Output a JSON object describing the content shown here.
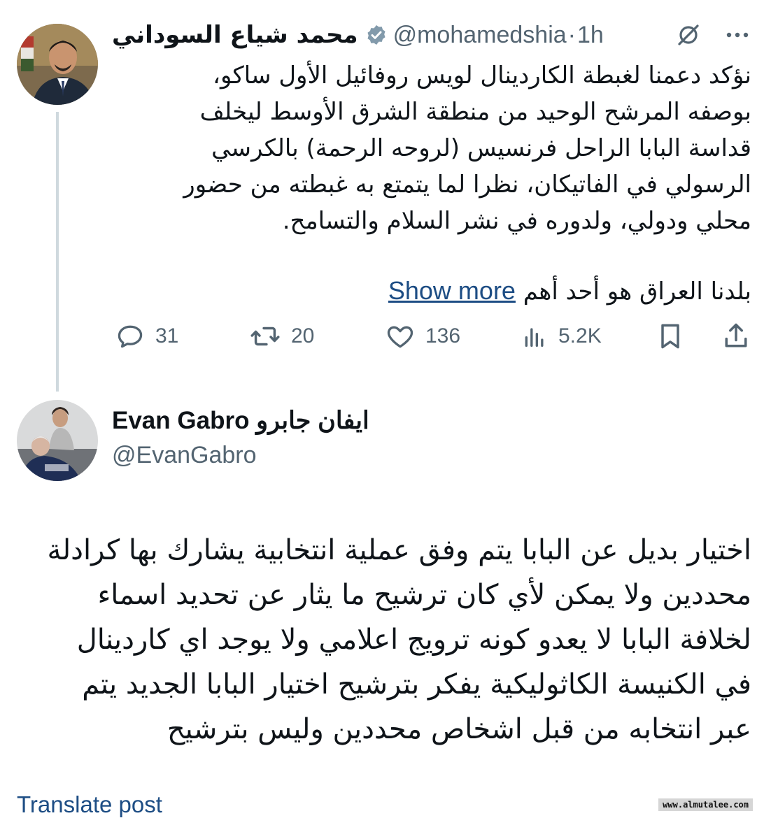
{
  "tweet": {
    "author_name": "محمد شياع السوداني",
    "handle": "@mohamedshia",
    "separator": "·",
    "time": "1h",
    "body_lines": [
      "نؤكد دعمنا لغبطة الكاردينال لويس روفائيل الأول ساكو،",
      "بوصفه المرشح الوحيد من منطقة الشرق الأوسط ليخلف",
      "قداسة البابا الراحل فرنسيس (لروحه الرحمة) بالكرسي",
      "الرسولي في الفاتيكان، نظرا لما يتمتع به غبطته من حضور",
      "محلي ودولي، ولدوره في نشر السلام والتسامح."
    ],
    "body_second_paragraph": "بلدنا العراق هو أحد أهم",
    "show_more_label": "Show more",
    "stats": {
      "replies": "31",
      "reposts": "20",
      "likes": "136",
      "views": "5.2K"
    }
  },
  "reply": {
    "author_name": "Evan Gabro ايفان جابرو",
    "handle": "@EvanGabro",
    "body_lines": [
      "اختيار بديل عن البابا يتم وفق عملية انتخابية يشارك بها كرادلة",
      "محددين ولا يمكن لأي كان ترشيح ما يثار عن تحديد اسماء",
      "لخلافة البابا لا يعدو كونه ترويج اعلامي ولا يوجد اي كاردينال",
      "في الكنيسة الكاثوليكية يفكر بترشيح اختيار البابا الجديد يتم",
      "عبر انتخابه من قبل اشخاص محددين وليس بترشيح"
    ],
    "translate_label": "Translate post"
  },
  "watermark": "www.almutalee.com",
  "colors": {
    "text": "#0f1419",
    "muted": "#536471",
    "link": "#1d4d84",
    "thread_line": "#cfd9de"
  },
  "icons": [
    "verified-badge-icon",
    "grok-icon",
    "more-icon",
    "reply-icon",
    "repost-icon",
    "like-icon",
    "views-icon",
    "bookmark-icon",
    "share-icon"
  ]
}
